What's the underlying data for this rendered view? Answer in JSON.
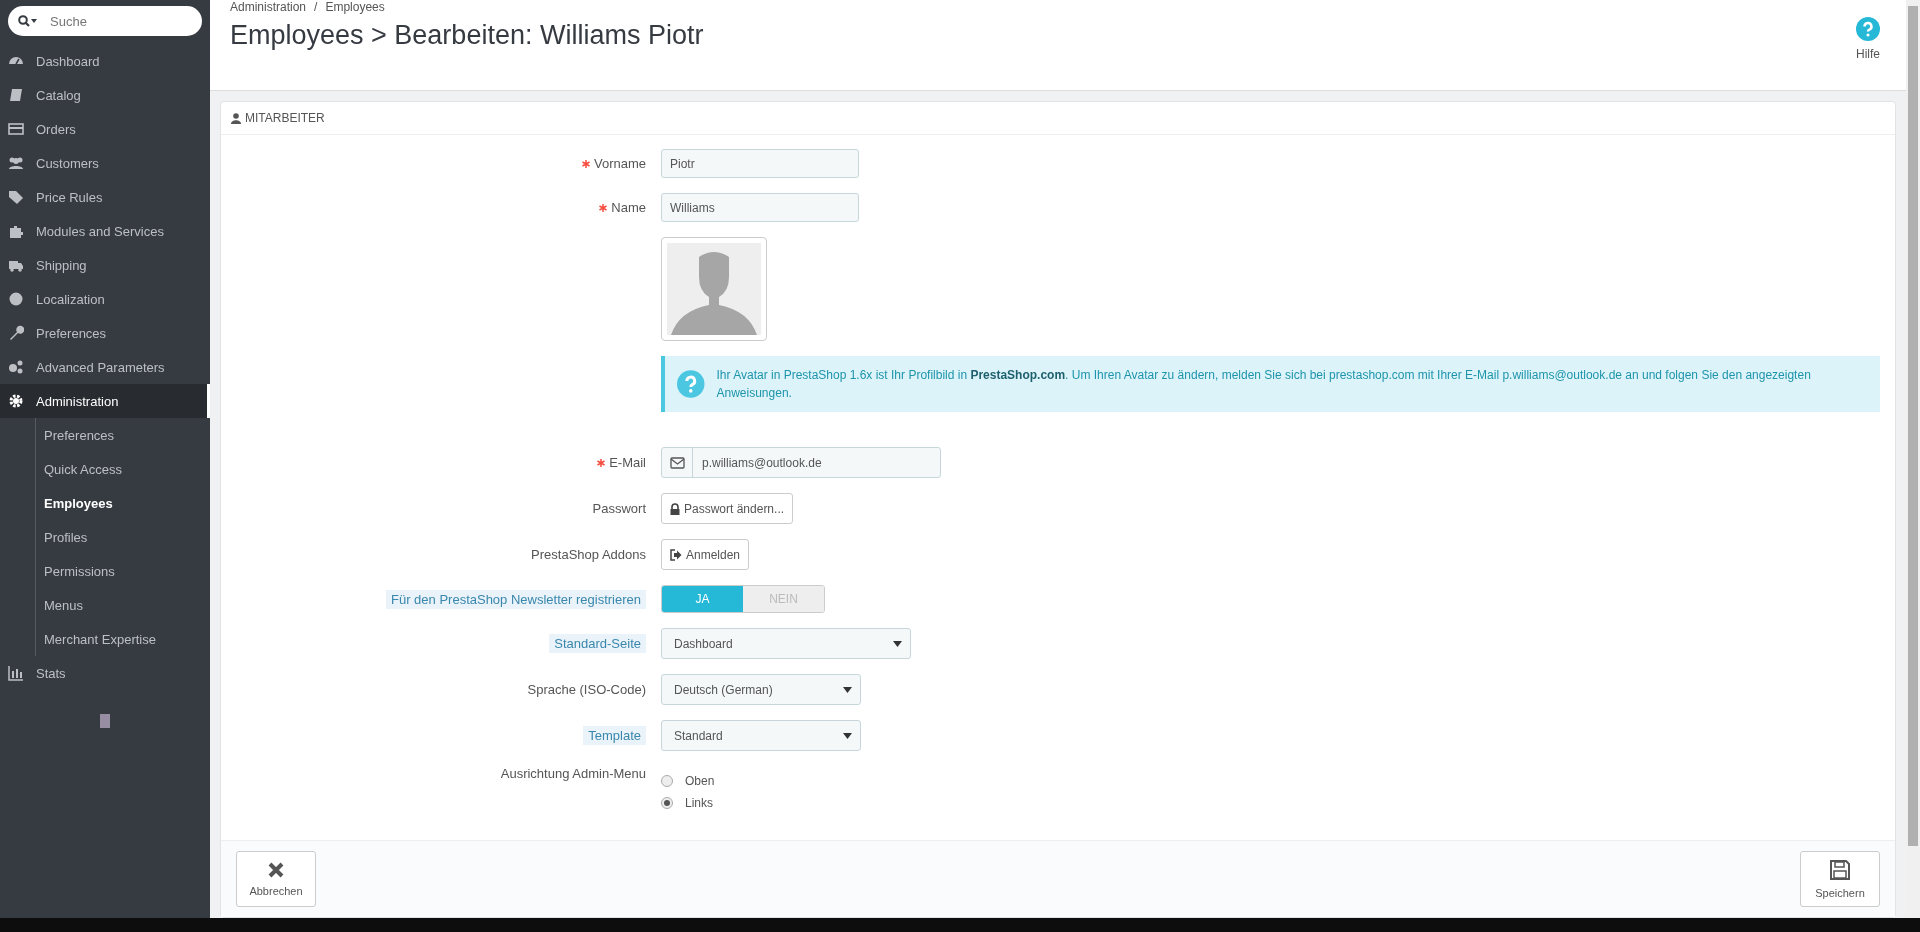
{
  "search": {
    "placeholder": "Suche"
  },
  "sidebar": {
    "items": [
      {
        "label": "Dashboard",
        "selected": false
      },
      {
        "label": "Catalog",
        "selected": false
      },
      {
        "label": "Orders",
        "selected": false
      },
      {
        "label": "Customers",
        "selected": false
      },
      {
        "label": "Price Rules",
        "selected": false
      },
      {
        "label": "Modules and Services",
        "selected": false
      },
      {
        "label": "Shipping",
        "selected": false
      },
      {
        "label": "Localization",
        "selected": false
      },
      {
        "label": "Preferences",
        "selected": false
      },
      {
        "label": "Advanced Parameters",
        "selected": false
      },
      {
        "label": "Administration",
        "selected": true,
        "children": [
          {
            "label": "Preferences",
            "selected": false
          },
          {
            "label": "Quick Access",
            "selected": false
          },
          {
            "label": "Employees",
            "selected": true
          },
          {
            "label": "Profiles",
            "selected": false
          },
          {
            "label": "Permissions",
            "selected": false
          },
          {
            "label": "Menus",
            "selected": false
          },
          {
            "label": "Merchant Expertise",
            "selected": false
          }
        ]
      },
      {
        "label": "Stats",
        "selected": false
      }
    ]
  },
  "breadcrumb": [
    "Administration",
    "Employees"
  ],
  "breadcrumb_separator": "/",
  "page_title": "Employees > Bearbeiten: Williams Piotr",
  "help_button": {
    "label": "Hilfe"
  },
  "panel": {
    "title": "MITARBEITER",
    "fields": [
      {
        "kind": "text",
        "label": "Vorname",
        "required": true,
        "hint": false,
        "value": "Piotr"
      },
      {
        "kind": "text",
        "label": "Name",
        "required": true,
        "hint": false,
        "value": "Williams"
      },
      {
        "kind": "avatar"
      },
      {
        "kind": "info",
        "text": "Ihr Avatar in PrestaShop 1.6x ist Ihr Profilbild in **PrestaShop.com**. Um Ihren Avatar zu ändern, melden Sie sich bei prestashop.com mit Ihrer E-Mail p.williams@outlook.de an und folgen Sie den angezeigten Anweisungen."
      },
      {
        "kind": "email",
        "label": "E-Mail",
        "required": true,
        "hint": false,
        "value": "p.williams@outlook.de"
      },
      {
        "kind": "password",
        "label": "Passwort",
        "required": false,
        "hint": false,
        "button": "Passwort ändern..."
      },
      {
        "kind": "login",
        "label": "PrestaShop Addons",
        "required": false,
        "hint": false,
        "button": "Anmelden"
      },
      {
        "kind": "toggle",
        "label": "Für den PrestaShop Newsletter registrieren",
        "required": false,
        "hint": true,
        "options": [
          {
            "label": "JA",
            "selected": true
          },
          {
            "label": "NEIN",
            "selected": false
          }
        ]
      },
      {
        "kind": "select",
        "label": "Standard-Seite",
        "required": false,
        "hint": true,
        "wide": true,
        "value": "Dashboard"
      },
      {
        "kind": "select",
        "label": "Sprache (ISO-Code)",
        "required": false,
        "hint": false,
        "wide": false,
        "value": "Deutsch (German)"
      },
      {
        "kind": "select",
        "label": "Template",
        "required": false,
        "hint": true,
        "wide": false,
        "value": "Standard"
      },
      {
        "kind": "radio",
        "label": "Ausrichtung Admin-Menu",
        "required": false,
        "hint": false,
        "options": [
          {
            "label": "Oben",
            "selected": false
          },
          {
            "label": "Links",
            "selected": true
          }
        ]
      }
    ],
    "footer": {
      "cancel": "Abbrechen",
      "save": "Speichern"
    }
  }
}
